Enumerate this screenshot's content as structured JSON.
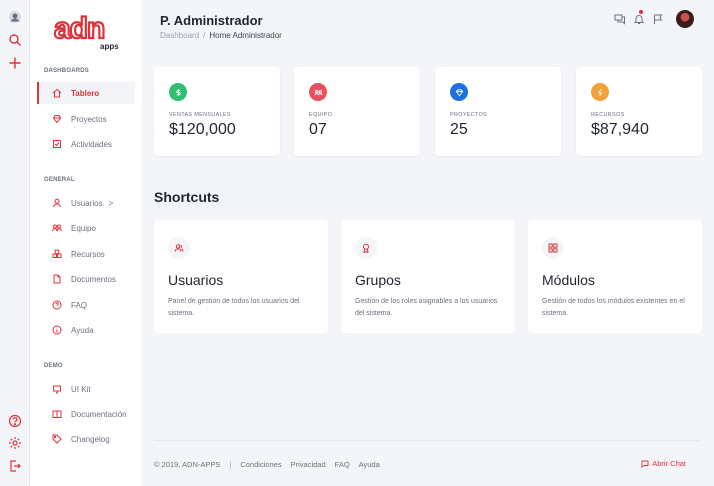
{
  "brand": {
    "logo_text": "adn",
    "logo_sub": "apps",
    "accent": "#e0323a"
  },
  "rail": {
    "icons": [
      "avatar-icon",
      "search-icon",
      "plus-icon",
      "help-icon",
      "settings-icon",
      "logout-icon"
    ]
  },
  "sidebar": {
    "sections": [
      {
        "title": "DASHBOARDS",
        "items": [
          {
            "label": "Tablero",
            "icon": "home-icon",
            "active": true
          },
          {
            "label": "Proyectos",
            "icon": "diamond-icon"
          },
          {
            "label": "Actividades",
            "icon": "checklist-icon"
          }
        ]
      },
      {
        "title": "GENERAL",
        "items": [
          {
            "label": "Usuarios",
            "icon": "user-icon",
            "chevron": ">"
          },
          {
            "label": "Equipo",
            "icon": "team-icon"
          },
          {
            "label": "Recursos",
            "icon": "boxes-icon"
          },
          {
            "label": "Documentos",
            "icon": "document-icon"
          },
          {
            "label": "FAQ",
            "icon": "question-icon"
          },
          {
            "label": "Ayuda",
            "icon": "info-icon"
          }
        ]
      },
      {
        "title": "DEMO",
        "items": [
          {
            "label": "UI Kit",
            "icon": "ui-kit-icon"
          },
          {
            "label": "Documentación",
            "icon": "book-icon"
          },
          {
            "label": "Changelog",
            "icon": "tag-icon"
          }
        ]
      }
    ]
  },
  "header": {
    "title": "P. Administrador",
    "breadcrumb": [
      "Dashboard",
      "/",
      "Home Administrador"
    ]
  },
  "stats": [
    {
      "label": "VENTAS MENSUALES",
      "value": "$120,000",
      "color": "#2fbf71",
      "icon": "dollar-icon"
    },
    {
      "label": "EQUIPO",
      "value": "07",
      "color": "#e8505b",
      "icon": "team-icon"
    },
    {
      "label": "PROYECTOS",
      "value": "25",
      "color": "#1f6fe0",
      "icon": "diamond-icon"
    },
    {
      "label": "RECURSOS",
      "value": "$87,940",
      "color": "#f2a23a",
      "icon": "lightning-icon"
    }
  ],
  "shortcuts": {
    "title": "Shortcuts",
    "items": [
      {
        "title": "Usuarios",
        "desc": "Panel de gestión de todos los usuarios del sistema.",
        "icon": "users-icon"
      },
      {
        "title": "Grupos",
        "desc": "Gestión de los roles asignables a los usuarios del sistema.",
        "icon": "badge-icon"
      },
      {
        "title": "Módulos",
        "desc": "Gestión de todos los módulos existentes en el sistema.",
        "icon": "grid-icon"
      }
    ]
  },
  "footer": {
    "copyright": "© 2019, ADN-APPS",
    "separator": "|",
    "links": [
      "Condiciones",
      "Privacidad",
      "FAQ",
      "Ayuda"
    ],
    "chat": "Abrir Chat"
  }
}
